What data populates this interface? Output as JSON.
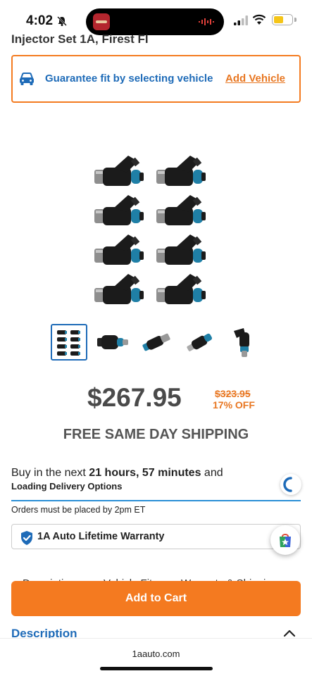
{
  "status_bar": {
    "time": "4:02",
    "battery_color": "#f5c518"
  },
  "page": {
    "cut_title": "Injector Set 1A, Firest FI"
  },
  "guarantee": {
    "text": "Guarantee fit by selecting vehicle",
    "link": "Add Vehicle",
    "icon": "car-icon"
  },
  "gallery": {
    "thumbnail_count": 5,
    "active_index": 0
  },
  "pricing": {
    "price": "$267.95",
    "old_price": "$323.95",
    "discount": "17% OFF"
  },
  "shipping": {
    "headline": "FREE SAME DAY SHIPPING",
    "buy_prefix": "Buy in the next ",
    "buy_time": "21 hours, 57 minutes",
    "buy_suffix": " and",
    "loading": "Loading Delivery Options",
    "cutoff": "Orders must be placed by 2pm ET"
  },
  "warranty": {
    "text": "1A Auto Lifetime Warranty",
    "icon": "shield-check-icon"
  },
  "tabs": [
    {
      "label": "Description"
    },
    {
      "label": "Vehicle Fit"
    },
    {
      "label": "Warranty & Shipping"
    }
  ],
  "cart": {
    "button_label": "Add to Cart"
  },
  "description": {
    "heading": "Description"
  },
  "browser": {
    "url": "1aauto.com"
  },
  "colors": {
    "accent_orange": "#f47a20",
    "link_blue": "#1e6bb8"
  }
}
